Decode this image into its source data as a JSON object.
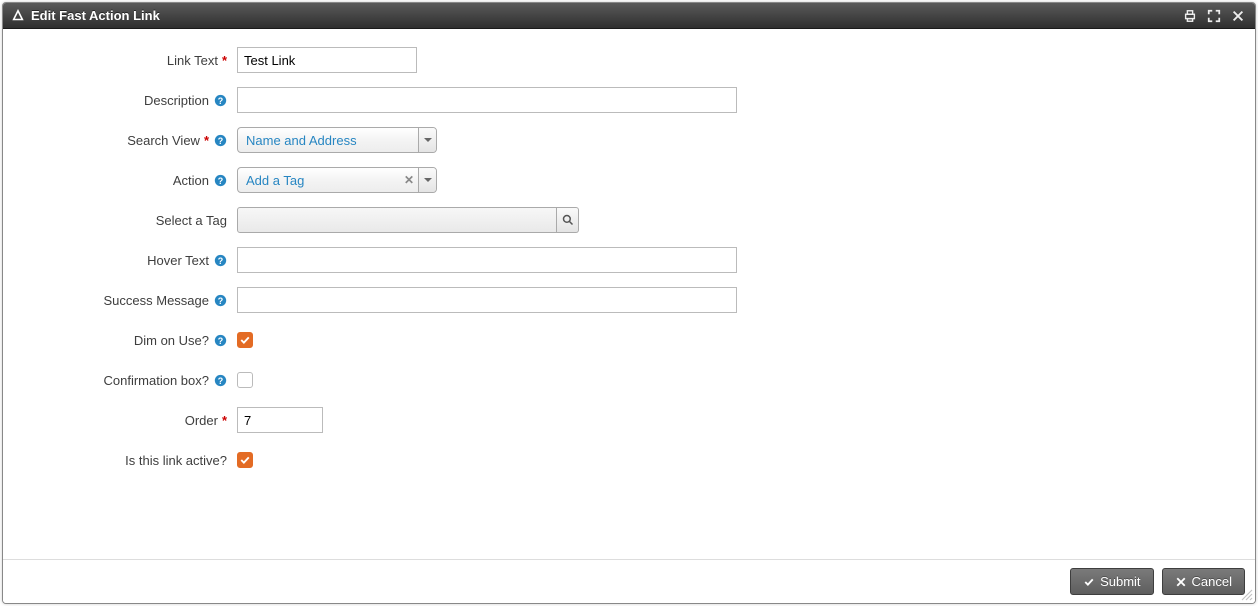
{
  "dialog": {
    "title": "Edit Fast Action Link"
  },
  "form": {
    "link_text": {
      "label": "Link Text",
      "value": "Test Link"
    },
    "description": {
      "label": "Description",
      "value": ""
    },
    "search_view": {
      "label": "Search View",
      "value": "Name and Address"
    },
    "action": {
      "label": "Action",
      "value": "Add a Tag"
    },
    "select_tag": {
      "label": "Select a Tag",
      "value": ""
    },
    "hover_text": {
      "label": "Hover Text",
      "value": ""
    },
    "success_message": {
      "label": "Success Message",
      "value": ""
    },
    "dim_on_use": {
      "label": "Dim on Use?",
      "checked": true
    },
    "confirmation_box": {
      "label": "Confirmation box?",
      "checked": false
    },
    "order": {
      "label": "Order",
      "value": "7"
    },
    "is_active": {
      "label": "Is this link active?",
      "checked": true
    }
  },
  "buttons": {
    "submit": "Submit",
    "cancel": "Cancel"
  }
}
